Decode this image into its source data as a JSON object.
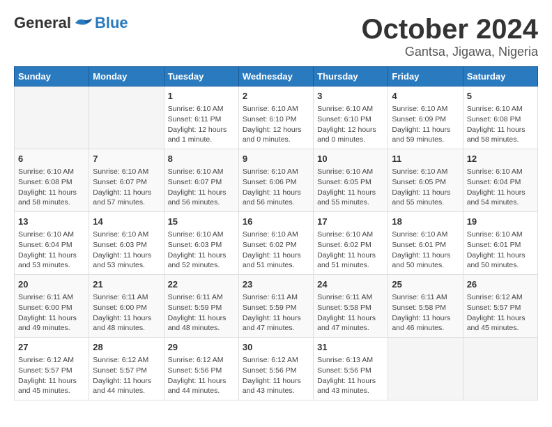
{
  "logo": {
    "general": "General",
    "blue": "Blue"
  },
  "title": {
    "month_year": "October 2024",
    "location": "Gantsa, Jigawa, Nigeria"
  },
  "weekdays": [
    "Sunday",
    "Monday",
    "Tuesday",
    "Wednesday",
    "Thursday",
    "Friday",
    "Saturday"
  ],
  "weeks": [
    [
      {
        "day": "",
        "info": ""
      },
      {
        "day": "",
        "info": ""
      },
      {
        "day": "1",
        "info": "Sunrise: 6:10 AM\nSunset: 6:11 PM\nDaylight: 12 hours\nand 1 minute."
      },
      {
        "day": "2",
        "info": "Sunrise: 6:10 AM\nSunset: 6:10 PM\nDaylight: 12 hours\nand 0 minutes."
      },
      {
        "day": "3",
        "info": "Sunrise: 6:10 AM\nSunset: 6:10 PM\nDaylight: 12 hours\nand 0 minutes."
      },
      {
        "day": "4",
        "info": "Sunrise: 6:10 AM\nSunset: 6:09 PM\nDaylight: 11 hours\nand 59 minutes."
      },
      {
        "day": "5",
        "info": "Sunrise: 6:10 AM\nSunset: 6:08 PM\nDaylight: 11 hours\nand 58 minutes."
      }
    ],
    [
      {
        "day": "6",
        "info": "Sunrise: 6:10 AM\nSunset: 6:08 PM\nDaylight: 11 hours\nand 58 minutes."
      },
      {
        "day": "7",
        "info": "Sunrise: 6:10 AM\nSunset: 6:07 PM\nDaylight: 11 hours\nand 57 minutes."
      },
      {
        "day": "8",
        "info": "Sunrise: 6:10 AM\nSunset: 6:07 PM\nDaylight: 11 hours\nand 56 minutes."
      },
      {
        "day": "9",
        "info": "Sunrise: 6:10 AM\nSunset: 6:06 PM\nDaylight: 11 hours\nand 56 minutes."
      },
      {
        "day": "10",
        "info": "Sunrise: 6:10 AM\nSunset: 6:05 PM\nDaylight: 11 hours\nand 55 minutes."
      },
      {
        "day": "11",
        "info": "Sunrise: 6:10 AM\nSunset: 6:05 PM\nDaylight: 11 hours\nand 55 minutes."
      },
      {
        "day": "12",
        "info": "Sunrise: 6:10 AM\nSunset: 6:04 PM\nDaylight: 11 hours\nand 54 minutes."
      }
    ],
    [
      {
        "day": "13",
        "info": "Sunrise: 6:10 AM\nSunset: 6:04 PM\nDaylight: 11 hours\nand 53 minutes."
      },
      {
        "day": "14",
        "info": "Sunrise: 6:10 AM\nSunset: 6:03 PM\nDaylight: 11 hours\nand 53 minutes."
      },
      {
        "day": "15",
        "info": "Sunrise: 6:10 AM\nSunset: 6:03 PM\nDaylight: 11 hours\nand 52 minutes."
      },
      {
        "day": "16",
        "info": "Sunrise: 6:10 AM\nSunset: 6:02 PM\nDaylight: 11 hours\nand 51 minutes."
      },
      {
        "day": "17",
        "info": "Sunrise: 6:10 AM\nSunset: 6:02 PM\nDaylight: 11 hours\nand 51 minutes."
      },
      {
        "day": "18",
        "info": "Sunrise: 6:10 AM\nSunset: 6:01 PM\nDaylight: 11 hours\nand 50 minutes."
      },
      {
        "day": "19",
        "info": "Sunrise: 6:10 AM\nSunset: 6:01 PM\nDaylight: 11 hours\nand 50 minutes."
      }
    ],
    [
      {
        "day": "20",
        "info": "Sunrise: 6:11 AM\nSunset: 6:00 PM\nDaylight: 11 hours\nand 49 minutes."
      },
      {
        "day": "21",
        "info": "Sunrise: 6:11 AM\nSunset: 6:00 PM\nDaylight: 11 hours\nand 48 minutes."
      },
      {
        "day": "22",
        "info": "Sunrise: 6:11 AM\nSunset: 5:59 PM\nDaylight: 11 hours\nand 48 minutes."
      },
      {
        "day": "23",
        "info": "Sunrise: 6:11 AM\nSunset: 5:59 PM\nDaylight: 11 hours\nand 47 minutes."
      },
      {
        "day": "24",
        "info": "Sunrise: 6:11 AM\nSunset: 5:58 PM\nDaylight: 11 hours\nand 47 minutes."
      },
      {
        "day": "25",
        "info": "Sunrise: 6:11 AM\nSunset: 5:58 PM\nDaylight: 11 hours\nand 46 minutes."
      },
      {
        "day": "26",
        "info": "Sunrise: 6:12 AM\nSunset: 5:57 PM\nDaylight: 11 hours\nand 45 minutes."
      }
    ],
    [
      {
        "day": "27",
        "info": "Sunrise: 6:12 AM\nSunset: 5:57 PM\nDaylight: 11 hours\nand 45 minutes."
      },
      {
        "day": "28",
        "info": "Sunrise: 6:12 AM\nSunset: 5:57 PM\nDaylight: 11 hours\nand 44 minutes."
      },
      {
        "day": "29",
        "info": "Sunrise: 6:12 AM\nSunset: 5:56 PM\nDaylight: 11 hours\nand 44 minutes."
      },
      {
        "day": "30",
        "info": "Sunrise: 6:12 AM\nSunset: 5:56 PM\nDaylight: 11 hours\nand 43 minutes."
      },
      {
        "day": "31",
        "info": "Sunrise: 6:13 AM\nSunset: 5:56 PM\nDaylight: 11 hours\nand 43 minutes."
      },
      {
        "day": "",
        "info": ""
      },
      {
        "day": "",
        "info": ""
      }
    ]
  ]
}
